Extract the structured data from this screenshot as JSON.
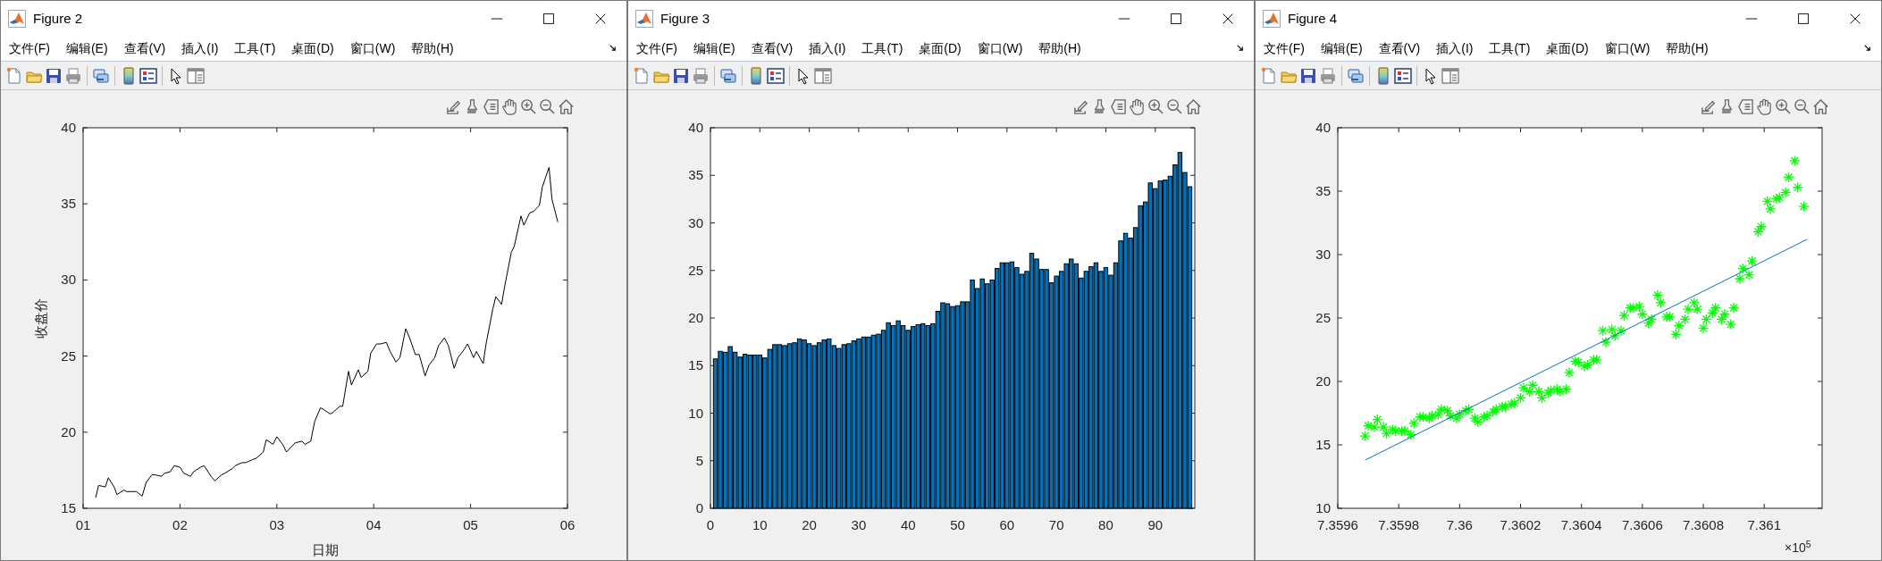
{
  "windows": [
    {
      "title": "Figure 2",
      "menu": [
        "文件(F)",
        "编辑(E)",
        "查看(V)",
        "插入(I)",
        "工具(T)",
        "桌面(D)",
        "窗口(W)",
        "帮助(H)"
      ],
      "axes": {
        "chart_data": {
          "type": "line",
          "xlabel": "日期",
          "ylabel": "收盘价",
          "xlim": [
            1,
            6
          ],
          "ylim": [
            15,
            40
          ],
          "xticks": [
            {
              "value": 1,
              "label": "01"
            },
            {
              "value": 2,
              "label": "02"
            },
            {
              "value": 3,
              "label": "03"
            },
            {
              "value": 4,
              "label": "04"
            },
            {
              "value": 5,
              "label": "05"
            },
            {
              "value": 6,
              "label": "06"
            }
          ],
          "yticks": [
            15,
            20,
            25,
            30,
            35,
            40
          ],
          "x": [
            1.13,
            1.16,
            1.23,
            1.26,
            1.32,
            1.35,
            1.42,
            1.45,
            1.52,
            1.55,
            1.61,
            1.65,
            1.71,
            1.74,
            1.81,
            1.84,
            1.9,
            1.94,
            2.0,
            2.04,
            2.11,
            2.14,
            2.21,
            2.25,
            2.32,
            2.36,
            2.43,
            2.46,
            2.54,
            2.57,
            2.64,
            2.68,
            2.75,
            2.79,
            2.86,
            2.89,
            2.96,
            3.0,
            3.06,
            3.1,
            3.16,
            3.19,
            3.26,
            3.29,
            3.35,
            3.39,
            3.45,
            3.48,
            3.55,
            3.58,
            3.65,
            3.68,
            3.74,
            3.77,
            3.84,
            3.87,
            3.94,
            3.97,
            4.03,
            4.07,
            4.13,
            4.17,
            4.23,
            4.27,
            4.33,
            4.37,
            4.43,
            4.47,
            4.53,
            4.57,
            4.63,
            4.67,
            4.73,
            4.77,
            4.83,
            4.87,
            4.93,
            4.97,
            5.03,
            5.06,
            5.13,
            5.16,
            5.23,
            5.26,
            5.32,
            5.35,
            5.42,
            5.45,
            5.52,
            5.55,
            5.61,
            5.65,
            5.71,
            5.74,
            5.81,
            5.84,
            5.9
          ],
          "series": [
            {
              "color": "#000000",
              "values": [
                15.7,
                16.5,
                16.4,
                17.0,
                16.4,
                15.9,
                16.2,
                16.1,
                16.1,
                16.1,
                15.8,
                16.7,
                17.2,
                17.2,
                17.1,
                17.3,
                17.4,
                17.8,
                17.7,
                17.3,
                17.1,
                17.4,
                17.7,
                17.8,
                17.1,
                16.8,
                17.2,
                17.3,
                17.6,
                17.8,
                18.0,
                18.0,
                18.2,
                18.3,
                18.7,
                19.5,
                19.2,
                19.7,
                19.2,
                18.7,
                19.1,
                19.3,
                19.4,
                19.2,
                19.4,
                20.7,
                21.6,
                21.5,
                21.2,
                21.3,
                21.7,
                21.7,
                24.0,
                23.1,
                24.1,
                23.6,
                24.0,
                25.2,
                25.8,
                25.8,
                25.9,
                25.3,
                24.6,
                24.9,
                26.8,
                26.2,
                25.1,
                25.1,
                23.7,
                24.4,
                24.9,
                25.7,
                26.2,
                25.7,
                24.2,
                24.9,
                25.4,
                25.8,
                24.9,
                25.3,
                24.5,
                25.8,
                28.1,
                28.9,
                28.4,
                29.5,
                31.8,
                32.2,
                34.2,
                33.6,
                34.4,
                34.5,
                34.9,
                36.1,
                37.4,
                35.3,
                33.8
              ]
            }
          ]
        }
      }
    },
    {
      "title": "Figure 3",
      "menu": [
        "文件(F)",
        "编辑(E)",
        "查看(V)",
        "插入(I)",
        "工具(T)",
        "桌面(D)",
        "窗口(W)",
        "帮助(H)"
      ],
      "axes": {
        "chart_data": {
          "type": "bar",
          "xlim": [
            0,
            98
          ],
          "ylim": [
            0,
            40
          ],
          "xticks": [
            0,
            10,
            20,
            30,
            40,
            50,
            60,
            70,
            80,
            90
          ],
          "yticks": [
            0,
            5,
            10,
            15,
            20,
            25,
            30,
            35,
            40
          ],
          "x": [
            1,
            2,
            3,
            4,
            5,
            6,
            7,
            8,
            9,
            10,
            11,
            12,
            13,
            14,
            15,
            16,
            17,
            18,
            19,
            20,
            21,
            22,
            23,
            24,
            25,
            26,
            27,
            28,
            29,
            30,
            31,
            32,
            33,
            34,
            35,
            36,
            37,
            38,
            39,
            40,
            41,
            42,
            43,
            44,
            45,
            46,
            47,
            48,
            49,
            50,
            51,
            52,
            53,
            54,
            55,
            56,
            57,
            58,
            59,
            60,
            61,
            62,
            63,
            64,
            65,
            66,
            67,
            68,
            69,
            70,
            71,
            72,
            73,
            74,
            75,
            76,
            77,
            78,
            79,
            80,
            81,
            82,
            83,
            84,
            85,
            86,
            87,
            88,
            89,
            90,
            91,
            92,
            93,
            94,
            95,
            96,
            97
          ],
          "series": [
            {
              "color": "#0072bd",
              "values": [
                15.7,
                16.5,
                16.4,
                17.0,
                16.4,
                15.9,
                16.2,
                16.1,
                16.1,
                16.1,
                15.8,
                16.7,
                17.2,
                17.2,
                17.1,
                17.3,
                17.4,
                17.8,
                17.7,
                17.3,
                17.1,
                17.4,
                17.7,
                17.8,
                17.1,
                16.8,
                17.2,
                17.3,
                17.6,
                17.8,
                18.0,
                18.0,
                18.2,
                18.3,
                18.7,
                19.5,
                19.2,
                19.7,
                19.2,
                18.7,
                19.1,
                19.3,
                19.4,
                19.2,
                19.4,
                20.7,
                21.6,
                21.5,
                21.2,
                21.3,
                21.7,
                21.7,
                24.0,
                23.1,
                24.1,
                23.6,
                24.0,
                25.2,
                25.8,
                25.8,
                25.9,
                25.3,
                24.6,
                24.9,
                26.8,
                26.2,
                25.1,
                25.1,
                23.7,
                24.4,
                24.9,
                25.7,
                26.2,
                25.7,
                24.2,
                24.9,
                25.4,
                25.8,
                24.9,
                25.3,
                24.5,
                25.8,
                28.1,
                28.9,
                28.4,
                29.5,
                31.8,
                32.2,
                34.2,
                33.6,
                34.4,
                34.5,
                34.9,
                36.1,
                37.4,
                35.3,
                33.8
              ]
            }
          ]
        }
      }
    },
    {
      "title": "Figure 4",
      "menu": [
        "文件(F)",
        "编辑(E)",
        "查看(V)",
        "插入(I)",
        "工具(T)",
        "桌面(D)",
        "窗口(W)",
        "帮助(H)"
      ],
      "axes": {
        "x_multiplier": "×10$^{5}$",
        "chart_data": {
          "type": "scatter",
          "xlim": [
            7.3596,
            7.36119
          ],
          "ylim": [
            10,
            40
          ],
          "xticks": [
            {
              "value": 7.3596,
              "label": "7.3596"
            },
            {
              "value": 7.3598,
              "label": "7.3598"
            },
            {
              "value": 7.36,
              "label": "7.36"
            },
            {
              "value": 7.3602,
              "label": "7.3602"
            },
            {
              "value": 7.3604,
              "label": "7.3604"
            },
            {
              "value": 7.3606,
              "label": "7.3606"
            },
            {
              "value": 7.3608,
              "label": "7.3608"
            },
            {
              "value": 7.361,
              "label": "7.361"
            }
          ],
          "yticks": [
            10,
            15,
            20,
            25,
            30,
            35,
            40
          ],
          "x": [
            7.35969,
            7.3597,
            7.35972,
            7.35973,
            7.35975,
            7.35976,
            7.35978,
            7.35979,
            7.35981,
            7.35982,
            7.35984,
            7.35985,
            7.35987,
            7.35988,
            7.3599,
            7.35991,
            7.35993,
            7.35994,
            7.35996,
            7.35997,
            7.35999,
            7.36,
            7.36002,
            7.36003,
            7.36005,
            7.36006,
            7.36008,
            7.36009,
            7.36011,
            7.36012,
            7.36014,
            7.36015,
            7.36017,
            7.36018,
            7.3602,
            7.36021,
            7.36023,
            7.36024,
            7.36026,
            7.36027,
            7.36029,
            7.3603,
            7.36032,
            7.36033,
            7.36035,
            7.36036,
            7.36038,
            7.36039,
            7.36041,
            7.36042,
            7.36044,
            7.36045,
            7.36047,
            7.36048,
            7.3605,
            7.36051,
            7.36053,
            7.36054,
            7.36056,
            7.36057,
            7.36059,
            7.3606,
            7.36062,
            7.36063,
            7.36065,
            7.36066,
            7.36068,
            7.36069,
            7.36071,
            7.36072,
            7.36074,
            7.36075,
            7.36077,
            7.36078,
            7.3608,
            7.36081,
            7.36083,
            7.36084,
            7.36086,
            7.36087,
            7.36089,
            7.3609,
            7.36092,
            7.36093,
            7.36095,
            7.36096,
            7.36098,
            7.36099,
            7.36101,
            7.36102,
            7.36104,
            7.36105,
            7.36107,
            7.36108,
            7.3611,
            7.36111,
            7.36113
          ],
          "series": [
            {
              "color": "#00ff00",
              "values": [
                15.7,
                16.5,
                16.4,
                17.0,
                16.4,
                15.9,
                16.2,
                16.1,
                16.1,
                16.1,
                15.8,
                16.7,
                17.2,
                17.2,
                17.1,
                17.3,
                17.4,
                17.8,
                17.7,
                17.3,
                17.1,
                17.4,
                17.7,
                17.8,
                17.1,
                16.8,
                17.2,
                17.3,
                17.6,
                17.8,
                18.0,
                18.0,
                18.2,
                18.3,
                18.7,
                19.5,
                19.2,
                19.7,
                19.2,
                18.7,
                19.1,
                19.3,
                19.4,
                19.2,
                19.4,
                20.7,
                21.6,
                21.5,
                21.2,
                21.3,
                21.7,
                21.7,
                24.0,
                23.1,
                24.1,
                23.6,
                24.0,
                25.2,
                25.8,
                25.8,
                25.9,
                25.3,
                24.6,
                24.9,
                26.8,
                26.2,
                25.1,
                25.1,
                23.7,
                24.4,
                24.9,
                25.7,
                26.2,
                25.7,
                24.2,
                24.9,
                25.4,
                25.8,
                24.9,
                25.3,
                24.5,
                25.8,
                28.1,
                28.9,
                28.4,
                29.5,
                31.8,
                32.2,
                34.2,
                33.6,
                34.4,
                34.5,
                34.9,
                36.1,
                37.4,
                35.3,
                33.8
              ]
            },
            {
              "type": "line",
              "color": "#0072bd",
              "x": [
                7.35969,
                7.36114
              ],
              "values": [
                13.8,
                31.2
              ]
            }
          ]
        }
      }
    }
  ]
}
